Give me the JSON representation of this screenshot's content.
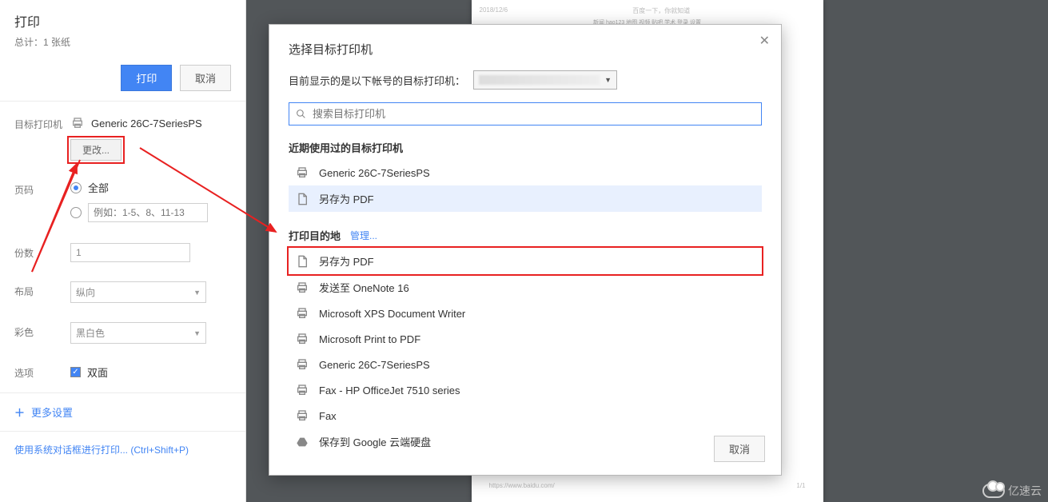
{
  "left": {
    "title": "打印",
    "total_label": "总计：1 张纸",
    "print_btn": "打印",
    "cancel_btn": "取消",
    "dest_label": "目标打印机",
    "dest_value": "Generic 26C-7SeriesPS",
    "change_btn": "更改...",
    "pages_label": "页码",
    "pages_all": "全部",
    "pages_range_placeholder": "例如：1-5、8、11-13",
    "copies_label": "份数",
    "copies_value": "1",
    "layout_label": "布局",
    "layout_value": "纵向",
    "color_label": "彩色",
    "color_value": "黑白色",
    "options_label": "选项",
    "options_duplex": "双面",
    "more_settings": "更多设置",
    "system_dialog": "使用系统对话框进行打印... (Ctrl+Shift+P)"
  },
  "preview": {
    "date": "2018/12/6",
    "headline": "百度一下，你就知道",
    "url": "https://www.baidu.com/",
    "page": "1/1"
  },
  "modal": {
    "title": "选择目标打印机",
    "account_line": "目前显示的是以下帐号的目标打印机：",
    "search_placeholder": "搜索目标打印机",
    "recent_label": "近期使用过的目标打印机",
    "recent": [
      {
        "icon": "printer",
        "name": "Generic 26C-7SeriesPS",
        "selected": false
      },
      {
        "icon": "file",
        "name": "另存为 PDF",
        "selected": true
      }
    ],
    "dest_label": "打印目的地",
    "manage": "管理...",
    "destinations": [
      {
        "icon": "file",
        "name": "另存为 PDF",
        "highlight": true
      },
      {
        "icon": "printer",
        "name": "发送至 OneNote 16"
      },
      {
        "icon": "printer",
        "name": "Microsoft XPS Document Writer"
      },
      {
        "icon": "printer",
        "name": "Microsoft Print to PDF"
      },
      {
        "icon": "printer",
        "name": "Generic 26C-7SeriesPS"
      },
      {
        "icon": "printer",
        "name": "Fax - HP OfficeJet 7510 series"
      },
      {
        "icon": "printer",
        "name": "Fax"
      },
      {
        "icon": "drive",
        "name": "保存到 Google 云端硬盘"
      }
    ],
    "cancel": "取消"
  },
  "watermark": "亿速云"
}
